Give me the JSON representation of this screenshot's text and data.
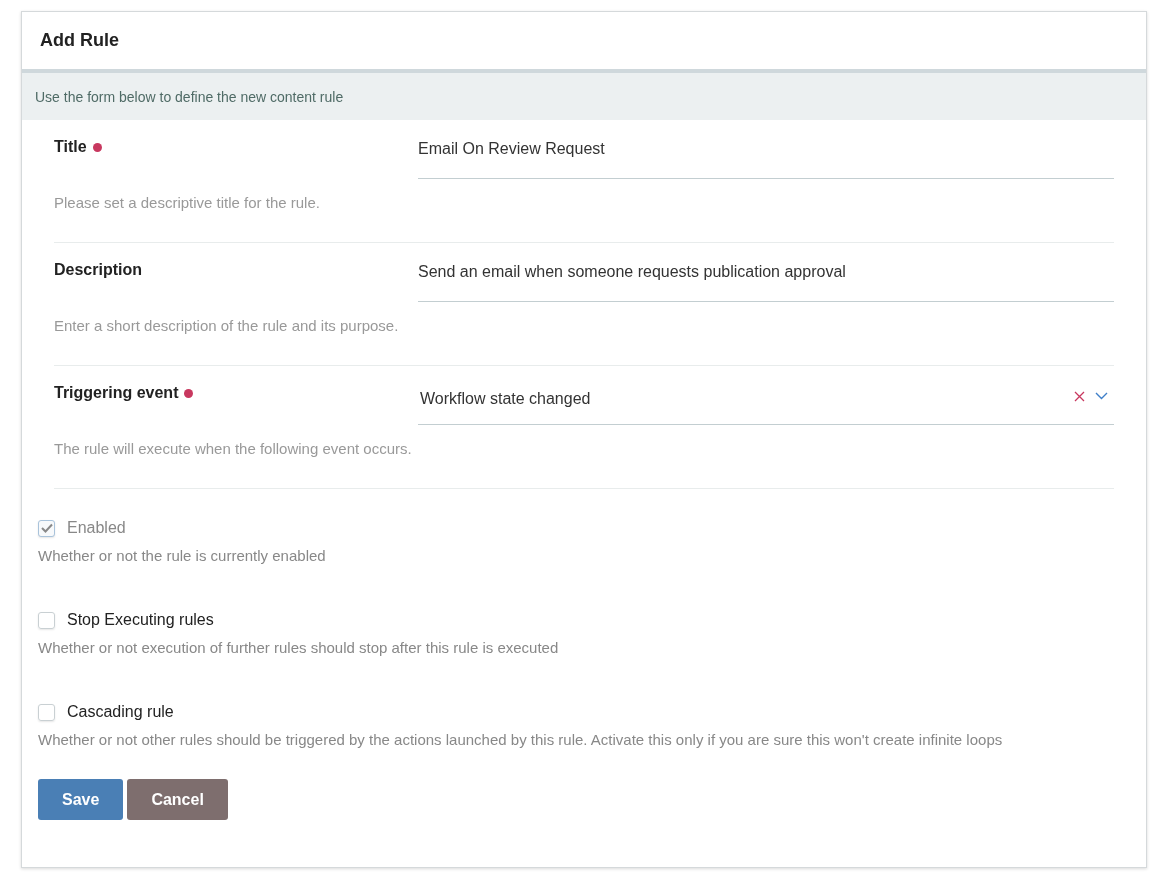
{
  "dialog": {
    "title": "Add Rule",
    "intro": "Use the form below to define the new content rule"
  },
  "fields": [
    {
      "kind": "text",
      "label": "Title",
      "required": true,
      "value": "Email On Review Request",
      "help": "Please set a descriptive title for the rule."
    },
    {
      "kind": "text",
      "label": "Description",
      "required": false,
      "value": "Send an email when someone requests publication approval",
      "help": "Enter a short description of the rule and its purpose."
    },
    {
      "kind": "select",
      "label": "Triggering event",
      "required": true,
      "value": "Workflow state changed",
      "help": "The rule will execute when the following event occurs."
    }
  ],
  "options": [
    {
      "label": "Enabled",
      "checked": true,
      "disabled": true,
      "help": "Whether or not the rule is currently enabled"
    },
    {
      "label": "Stop Executing rules",
      "checked": false,
      "disabled": false,
      "help": "Whether or not execution of further rules should stop after this rule is executed"
    },
    {
      "label": "Cascading rule",
      "checked": false,
      "disabled": false,
      "help": "Whether or not other rules should be triggered by the actions launched by this rule. Activate this only if you are sure this won't create infinite loops"
    }
  ],
  "buttons": [
    {
      "kind": "primary",
      "label": "Save"
    },
    {
      "kind": "secondary",
      "label": "Cancel"
    }
  ]
}
